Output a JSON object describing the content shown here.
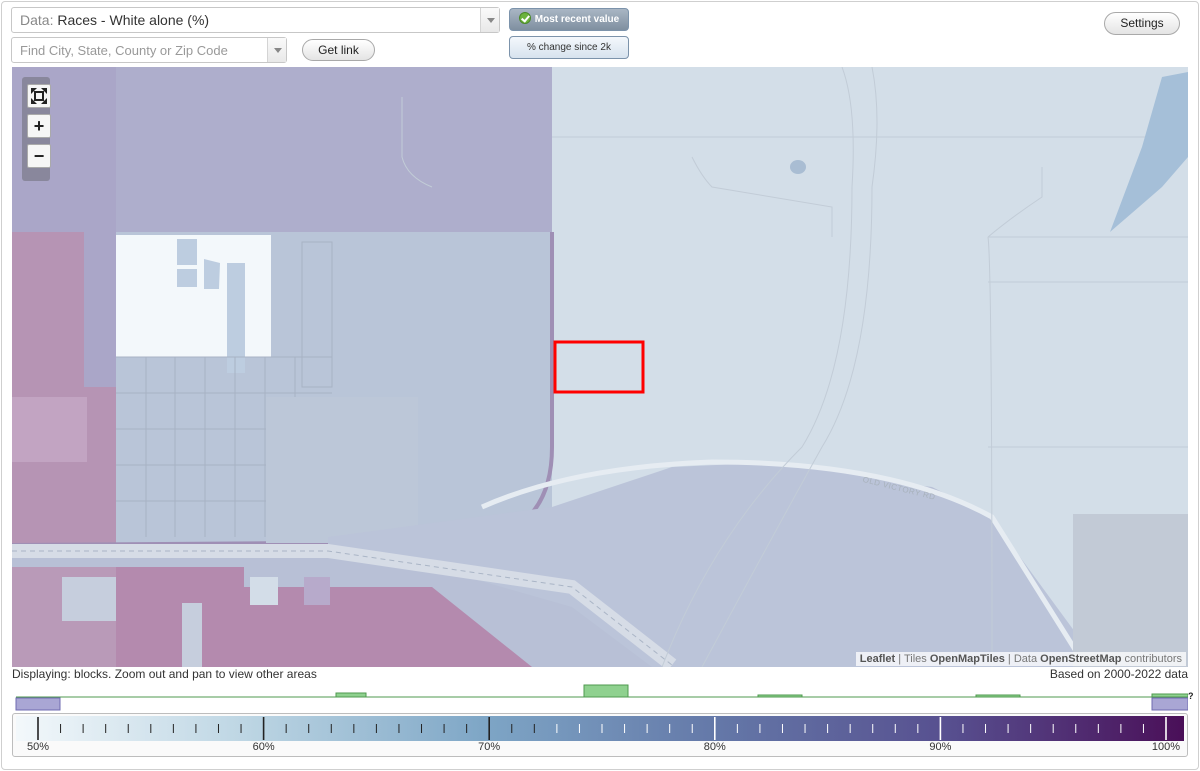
{
  "toolbar": {
    "data_label": "Data:",
    "data_value": "Races - White alone (%)",
    "search_placeholder": "Find City, State, County or Zip Code",
    "get_link": "Get link",
    "most_recent": "Most recent value",
    "percent_change": "% change since 2k",
    "settings": "Settings"
  },
  "map": {
    "zoom_fit_icon": "fit-extent-icon",
    "zoom_in": "+",
    "zoom_out": "−",
    "road_label": "OLD VICTORY RD",
    "attribution": {
      "leaflet": "Leaflet",
      "tiles_prefix": "Tiles",
      "tiles": "OpenMapTiles",
      "data_prefix": "Data",
      "data": "OpenStreetMap",
      "suffix": "contributors"
    },
    "selection_color": "#ff0000"
  },
  "status": {
    "displaying": "Displaying: blocks. Zoom out and pan to view other areas",
    "based_on": "Based on 2000-2022 data"
  },
  "legend": {
    "min": 50,
    "max": 100,
    "labels": [
      "50%",
      "60%",
      "70%",
      "80%",
      "90%",
      "100%"
    ],
    "unknown_mark": "?",
    "histogram_color": "#8fd18f",
    "nodata_color": "#a9a6d4"
  }
}
